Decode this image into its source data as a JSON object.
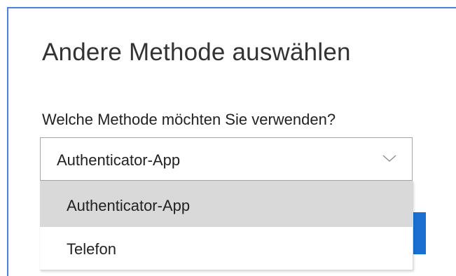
{
  "dialog": {
    "title": "Andere Methode auswählen",
    "question": "Welche Methode möchten Sie verwenden?"
  },
  "method_select": {
    "selected_value": "Authenticator-App",
    "options": [
      {
        "label": "Authenticator-App",
        "selected": true
      },
      {
        "label": "Telefon",
        "selected": false
      }
    ]
  },
  "icons": {
    "dropdown_arrow": "chevron-down-icon"
  },
  "colors": {
    "accent": "#1a6fd0",
    "frame_border": "#4f7fd8",
    "selected_option_bg": "#d9d9d9"
  }
}
